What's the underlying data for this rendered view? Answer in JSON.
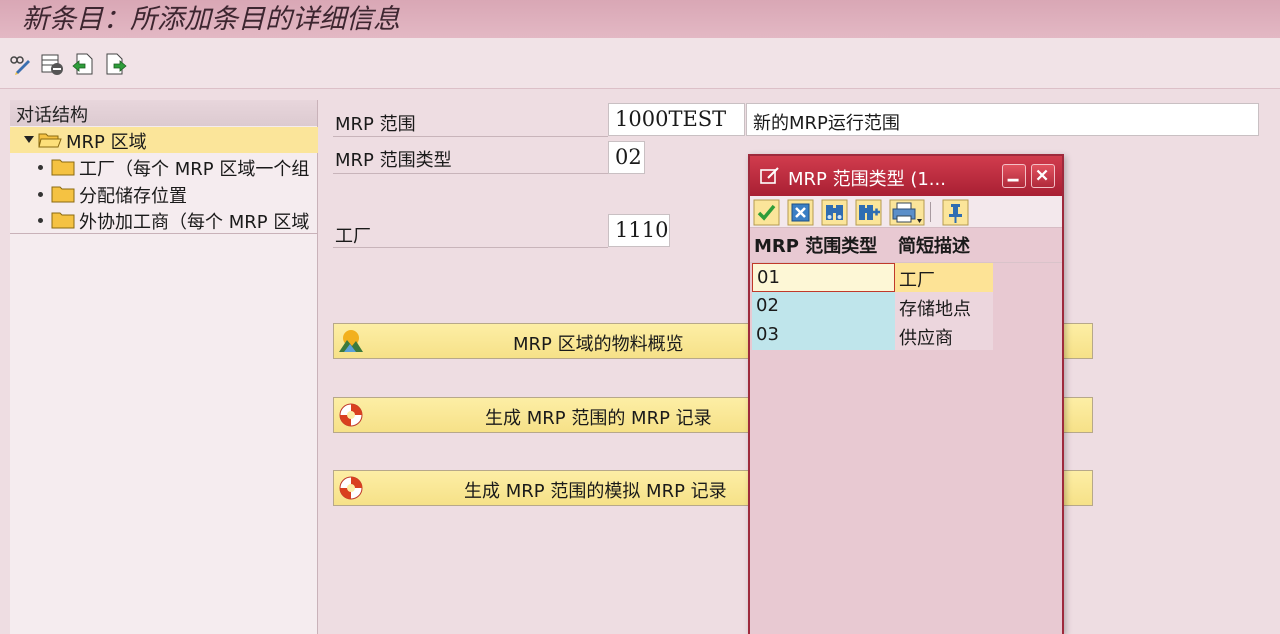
{
  "window": {
    "title": "新条目：所添加条目的详细信息"
  },
  "toolbar": {
    "items": [
      {
        "icon": "change-display-icon"
      },
      {
        "icon": "delete-row-icon"
      },
      {
        "icon": "previous-entry-icon"
      },
      {
        "icon": "next-entry-icon"
      }
    ]
  },
  "tree": {
    "header": "对话结构",
    "root": "MRP 区域",
    "children": [
      "工厂（每个 MRP 区域一个组",
      "分配储存位置",
      "外协加工商（每个 MRP 区域"
    ]
  },
  "form": {
    "mrp_area_label": "MRP 范围",
    "mrp_area_value": "1000TEST",
    "mrp_area_desc": "新的MRP运行范围",
    "mrp_type_label": "MRP 范围类型",
    "mrp_type_value": "02",
    "plant_label": "工厂",
    "plant_value": "1110"
  },
  "buttons": [
    {
      "label": "MRP 区域的物料概览",
      "icon": "material-overview-icon"
    },
    {
      "label": "生成 MRP 范围的 MRP 记录",
      "icon": "lifebuoy-icon"
    },
    {
      "label": "生成 MRP 范围的模拟 MRP 记录",
      "icon": "lifebuoy-icon"
    }
  ],
  "popup": {
    "title": "MRP 范围类型 (1...",
    "columns": [
      "MRP 范围类型",
      "简短描述"
    ],
    "rows": [
      {
        "key": "01",
        "text": "工厂"
      },
      {
        "key": "02",
        "text": "存储地点"
      },
      {
        "key": "03",
        "text": "供应商"
      }
    ],
    "tools": [
      "confirm-icon",
      "cancel-icon",
      "find-icon",
      "find-next-icon",
      "print-icon",
      "pin-icon"
    ]
  },
  "colors": {
    "title_bg": "#d9a7b5",
    "popup_title": "#b82a3d",
    "button_yellow": "#fbe99e",
    "key_column": "#bfe5eb",
    "selected_row": "#fde396"
  }
}
